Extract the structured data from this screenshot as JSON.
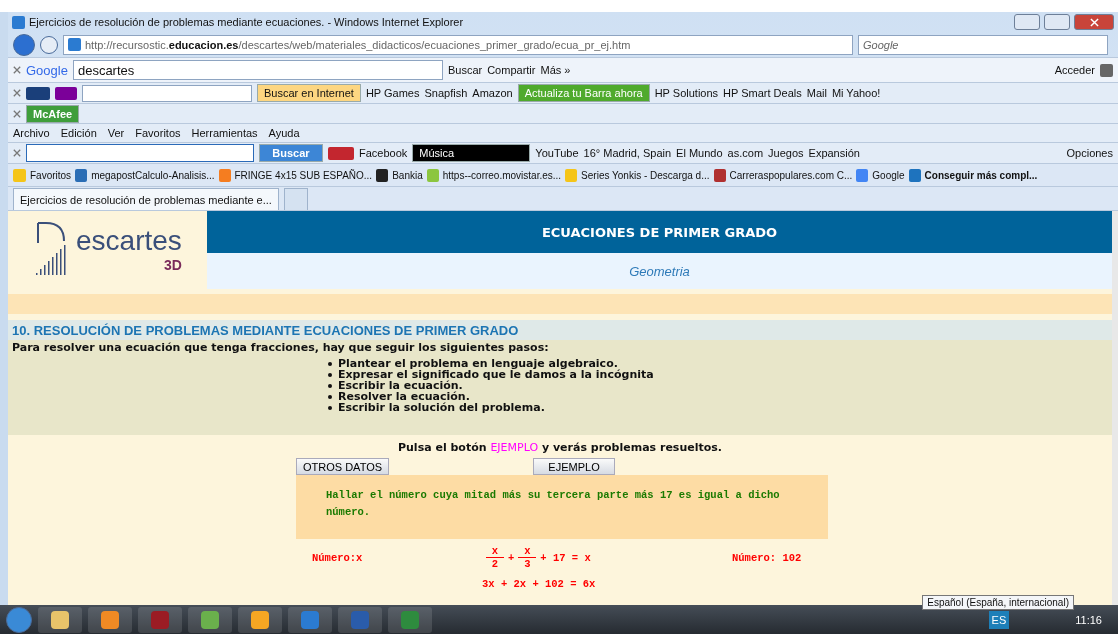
{
  "window": {
    "title": "Ejercicios de resolución de problemas mediante ecuaciones. - Windows Internet Explorer"
  },
  "address_bar": {
    "url_prefix": "http://recursostic.",
    "url_domain": "educacion.es",
    "url_path": "/descartes/web/materiales_didacticos/ecuaciones_primer_grado/ecua_pr_ej.htm",
    "search_placeholder": "Google"
  },
  "google_toolbar": {
    "brand": "Google",
    "query": "descartes",
    "items": [
      "Buscar",
      "Compartir",
      "Más »"
    ],
    "sign_in": "Acceder"
  },
  "yahoo_toolbar": {
    "search_button": "Buscar en Internet",
    "links": [
      "HP Games",
      "Snapfish",
      "Amazon"
    ],
    "update_button": "Actualiza tu Barra ahora",
    "links_right": [
      "HP Solutions",
      "HP Smart Deals",
      "Mail",
      "Mi Yahoo!"
    ]
  },
  "mcafee_toolbar": {
    "label": "McAfee"
  },
  "menu": [
    "Archivo",
    "Edición",
    "Ver",
    "Favoritos",
    "Herramientas",
    "Ayuda"
  ],
  "ask_toolbar": {
    "search_button": "Buscar",
    "facebook": "Facebook",
    "music": "Música",
    "links": [
      "YouTube",
      "16° Madrid, Spain",
      "El Mundo",
      "as.com",
      "Juegos",
      "Expansión"
    ],
    "options": "Opciones"
  },
  "favorites_bar": {
    "label": "Favoritos",
    "items": [
      {
        "label": "megapostCalculo-Analisis...",
        "color": "#2a6db5"
      },
      {
        "label": "FRINGE 4x15 SUB ESPAÑO...",
        "color": "#f57d20"
      },
      {
        "label": "Bankia",
        "color": "#222222"
      },
      {
        "label": "https--correo.movistar.es...",
        "color": "#8cc63f"
      },
      {
        "label": "Series Yonkis - Descarga d...",
        "color": "#f5c518"
      },
      {
        "label": "Carreraspopulares.com C...",
        "color": "#b03030"
      },
      {
        "label": "Google",
        "color": "#4285f4"
      },
      {
        "label": "Conseguir más compl...",
        "color": "#1e73be"
      }
    ]
  },
  "tabs": [
    {
      "label": "Ejercicios de resolución de problemas mediante e...",
      "selected": true
    }
  ],
  "page": {
    "logo_text": "escartes",
    "logo_sub": "3D",
    "header_title": "ECUACIONES DE PRIMER GRADO",
    "header_subtitle": "Geometria",
    "section_title": "10. RESOLUCIÓN DE PROBLEMAS MEDIANTE ECUACIONES DE PRIMER GRADO",
    "intro": "Para resolver una ecuación que tenga fracciones, hay que seguir los siguientes pasos:",
    "steps": [
      "Plantear el problema en lenguaje algebraico.",
      "Expresar el significado que le damos a la incógnita",
      "Escribir la ecuación.",
      "Resolver la ecuación.",
      "Escribir la solución del problema."
    ],
    "prompt_before": "Pulsa el botón ",
    "prompt_highlight": "EJEMPLO",
    "prompt_after": " y verás problemas resueltos.",
    "buttons": [
      "OTROS DATOS",
      "EJEMPLO"
    ],
    "problem": "Hallar el número cuya mitad más su tercera parte más 17 es igual a dicho número.",
    "unknown": "Número:x",
    "fraction_equation": {
      "fractions": [
        {
          "num": "x",
          "den": "2"
        },
        {
          "num": "x",
          "den": "3"
        }
      ],
      "operator": "+",
      "rest": "+ 17 = x"
    },
    "equation": "3x + 2x + 102 = 6x",
    "result": "Número: 102"
  },
  "taskbar": {
    "tooltip": "Español (España, internacional)",
    "language": "ES",
    "time": "11:16"
  }
}
